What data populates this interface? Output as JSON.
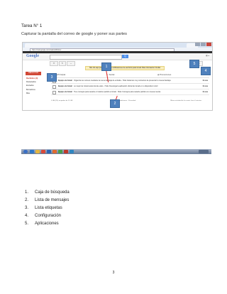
{
  "doc": {
    "title": "Tarea N° 1",
    "subtitle": "Capturar la pantalla del correo de google y poner sus partes",
    "page_number": "3"
  },
  "items": [
    {
      "num": "1.",
      "label": "Caja de búsqueda"
    },
    {
      "num": "2.",
      "label": "Lista de mensajes"
    },
    {
      "num": "3.",
      "label": "Lista etiquetas"
    },
    {
      "num": "4.",
      "label": "Configuración"
    },
    {
      "num": "5.",
      "label": "Aplicaciones"
    }
  ],
  "callouts": [
    "1",
    "2",
    "3",
    "4",
    "5"
  ],
  "screenshot": {
    "url": "https://mail.google.com/mail/u/0/#inbox",
    "logo": "Google",
    "search_button": "Q",
    "notice": "Haz clic aquí para habilitar las notificaciones de escritorio para Gmail. Más información Ocultar",
    "compose": "REDACTAR",
    "sidebar": [
      "Recibidos (3)",
      "Destacados",
      "Enviados",
      "Borradores",
      "Más"
    ],
    "tabs": [
      "Principal",
      "Social",
      "Promociones"
    ],
    "messages": [
      {
        "from": "Equipo de Gmail",
        "subject": "Organiza tus correos mediante la nueva bandeja de entrada - Hola: Estamos muy contentos de presentar tu nueva bandeja",
        "date": "11 ene"
      },
      {
        "from": "Equipo de Gmail",
        "subject": "Lo mejor de Gmail estés donde estés - Hola: Descarga la aplicación oficial de Gmail en tu dispositivo móvil",
        "date": "11 ene"
      },
      {
        "from": "Equipo de Gmail",
        "subject": "Tres consejos para sacarle el máximo partido a Gmail - Hola: Consejos para sacarle partido a tu nueva cuenta",
        "date": "11 ene"
      }
    ],
    "footer_left": "0 GB (0%) ocupados de 15 GB",
    "footer_mid": "Condiciones - Privacidad",
    "footer_right": "Última actividad de la cuenta: hace 0 minutos"
  }
}
